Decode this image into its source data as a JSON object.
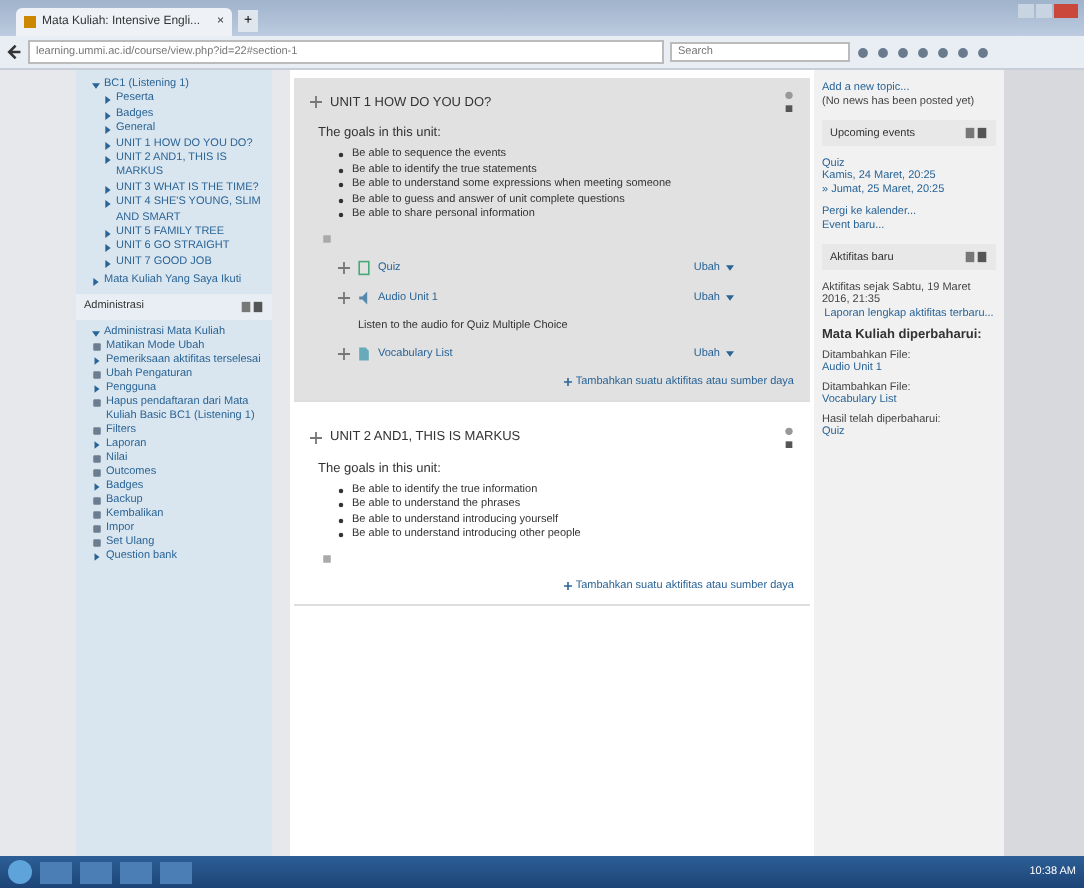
{
  "browser": {
    "tab": {
      "title": "Mata Kuliah: Intensive Engli...",
      "close": "×"
    },
    "new_tab": "+",
    "url": "learning.ummi.ac.id/course/view.php?id=22#section-1",
    "search": {
      "placeholder": "Search"
    }
  },
  "nav": {
    "title": "BC1 (Listening 1)",
    "items": [
      "Peserta",
      "Badges",
      "General",
      "UNIT 1 HOW DO YOU DO?",
      "UNIT 2 AND1, THIS IS MARKUS",
      "UNIT 3 WHAT IS THE TIME?",
      "UNIT 4 SHE'S YOUNG, SLIM AND SMART",
      "UNIT 5 FAMILY TREE",
      "UNIT 6 GO STRAIGHT",
      "UNIT 7 GOOD JOB"
    ],
    "footer": "Mata Kuliah Yang Saya Ikuti"
  },
  "admin": {
    "title": "Administrasi",
    "group": "Administrasi Mata Kuliah",
    "items": [
      {
        "label": "Matikan Mode Ubah",
        "kind": "icon"
      },
      {
        "label": "Pemeriksaan aktifitas terselesai",
        "kind": "arrow"
      },
      {
        "label": "Ubah Pengaturan",
        "kind": "icon"
      },
      {
        "label": "Pengguna",
        "kind": "arrow"
      },
      {
        "label": "Hapus pendaftaran dari Mata Kuliah Basic BC1 (Listening 1)",
        "kind": "icon"
      },
      {
        "label": "Filters",
        "kind": "icon"
      },
      {
        "label": "Laporan",
        "kind": "arrow"
      },
      {
        "label": "Nilai",
        "kind": "icon"
      },
      {
        "label": "Outcomes",
        "kind": "icon"
      },
      {
        "label": "Badges",
        "kind": "arrow"
      },
      {
        "label": "Backup",
        "kind": "icon"
      },
      {
        "label": "Kembalikan",
        "kind": "icon"
      },
      {
        "label": "Impor",
        "kind": "icon"
      },
      {
        "label": "Set Ulang",
        "kind": "icon"
      },
      {
        "label": "Question bank",
        "kind": "arrow"
      }
    ]
  },
  "sections": [
    {
      "title": "UNIT 1 HOW DO YOU DO?",
      "highlighted": true,
      "intro": "The goals in this unit:",
      "goals": [
        "Be able to sequence the events",
        "Be able to identify the true statements",
        "Be able to understand some expressions when meeting someone",
        "Be able to guess and answer of unit complete questions",
        "Be able to share personal information"
      ],
      "activities": [
        {
          "kind": "quiz",
          "name": "Quiz",
          "edit": "Ubah"
        },
        {
          "kind": "audio",
          "name": "Audio Unit 1",
          "edit": "Ubah"
        },
        {
          "kind": "label",
          "text": "Listen to the audio for Quiz Multiple Choice"
        },
        {
          "kind": "file",
          "name": "Vocabulary List",
          "edit": "Ubah"
        }
      ],
      "add": "Tambahkan suatu aktifitas atau sumber daya"
    },
    {
      "title": "UNIT 2 AND1, THIS IS MARKUS",
      "highlighted": false,
      "intro": "The goals in this unit:",
      "goals": [
        "Be able to identify the true information",
        "Be able to understand the phrases",
        "Be able to understand introducing yourself",
        "Be able to understand introducing other people"
      ],
      "add": "Tambahkan suatu aktifitas atau sumber daya"
    }
  ],
  "news": {
    "link": "Add a new topic...",
    "note": "(No news has been posted yet)"
  },
  "events": {
    "title": "Upcoming events",
    "items": [
      {
        "name": "Quiz",
        "time": "Kamis, 24 Maret, 20:25"
      },
      {
        "time": "» Jumat, 25 Maret, 20:25"
      }
    ],
    "calendar": "Pergi ke kalender...",
    "new_event": "Event baru..."
  },
  "recent": {
    "title": "Aktifitas baru",
    "since": "Aktifitas sejak Sabtu, 19 Maret 2016, 21:35",
    "full": "Laporan lengkap aktifitas terbaru...",
    "heading": "Mata Kuliah diperbaharui:",
    "entries": [
      {
        "label": "Ditambahkan File:",
        "link": "Audio Unit 1"
      },
      {
        "label": "Ditambahkan File:",
        "link": "Vocabulary List"
      },
      {
        "label": "Hasil telah diperbaharui:",
        "link": "Quiz"
      }
    ]
  },
  "taskbar": {
    "clock": "10:38 AM"
  }
}
